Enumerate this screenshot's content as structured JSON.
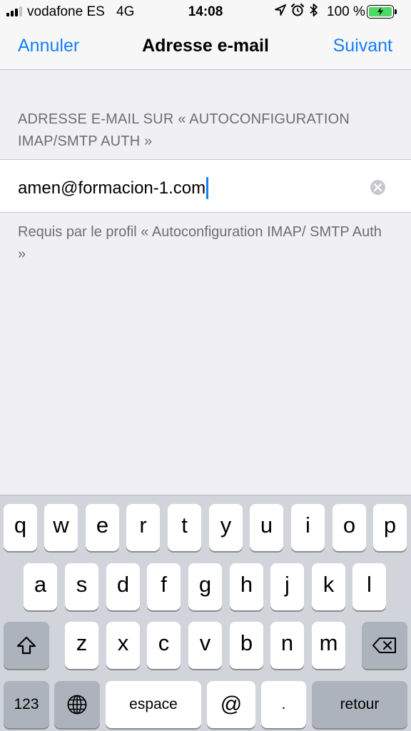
{
  "status_bar": {
    "carrier": "vodafone ES",
    "network": "4G",
    "time": "14:08",
    "battery_percent": "100 %",
    "battery_level": 1.0,
    "icons": [
      "location-arrow-icon",
      "alarm-clock-icon",
      "bluetooth-icon",
      "battery-charging-icon"
    ]
  },
  "nav": {
    "cancel_label": "Annuler",
    "title": "Adresse e-mail",
    "next_label": "Suivant"
  },
  "section": {
    "header": "ADRESSE E-MAIL SUR « AUTOCONFIGURATION IMAP/SMTP AUTH »",
    "email_value": "amen@formacion-1.com",
    "footer": "Requis par le profil « Autoconfiguration IMAP/ SMTP Auth »"
  },
  "keyboard": {
    "row1": [
      "q",
      "w",
      "e",
      "r",
      "t",
      "y",
      "u",
      "i",
      "o",
      "p"
    ],
    "row2": [
      "a",
      "s",
      "d",
      "f",
      "g",
      "h",
      "j",
      "k",
      "l"
    ],
    "row3": [
      "z",
      "x",
      "c",
      "v",
      "b",
      "n",
      "m"
    ],
    "numbers_label": "123",
    "space_label": "espace",
    "at_label": "@",
    "dot_label": ".",
    "return_label": "retour"
  },
  "colors": {
    "accent": "#157efb",
    "battery_green": "#4cd964",
    "background": "#efeff4"
  }
}
